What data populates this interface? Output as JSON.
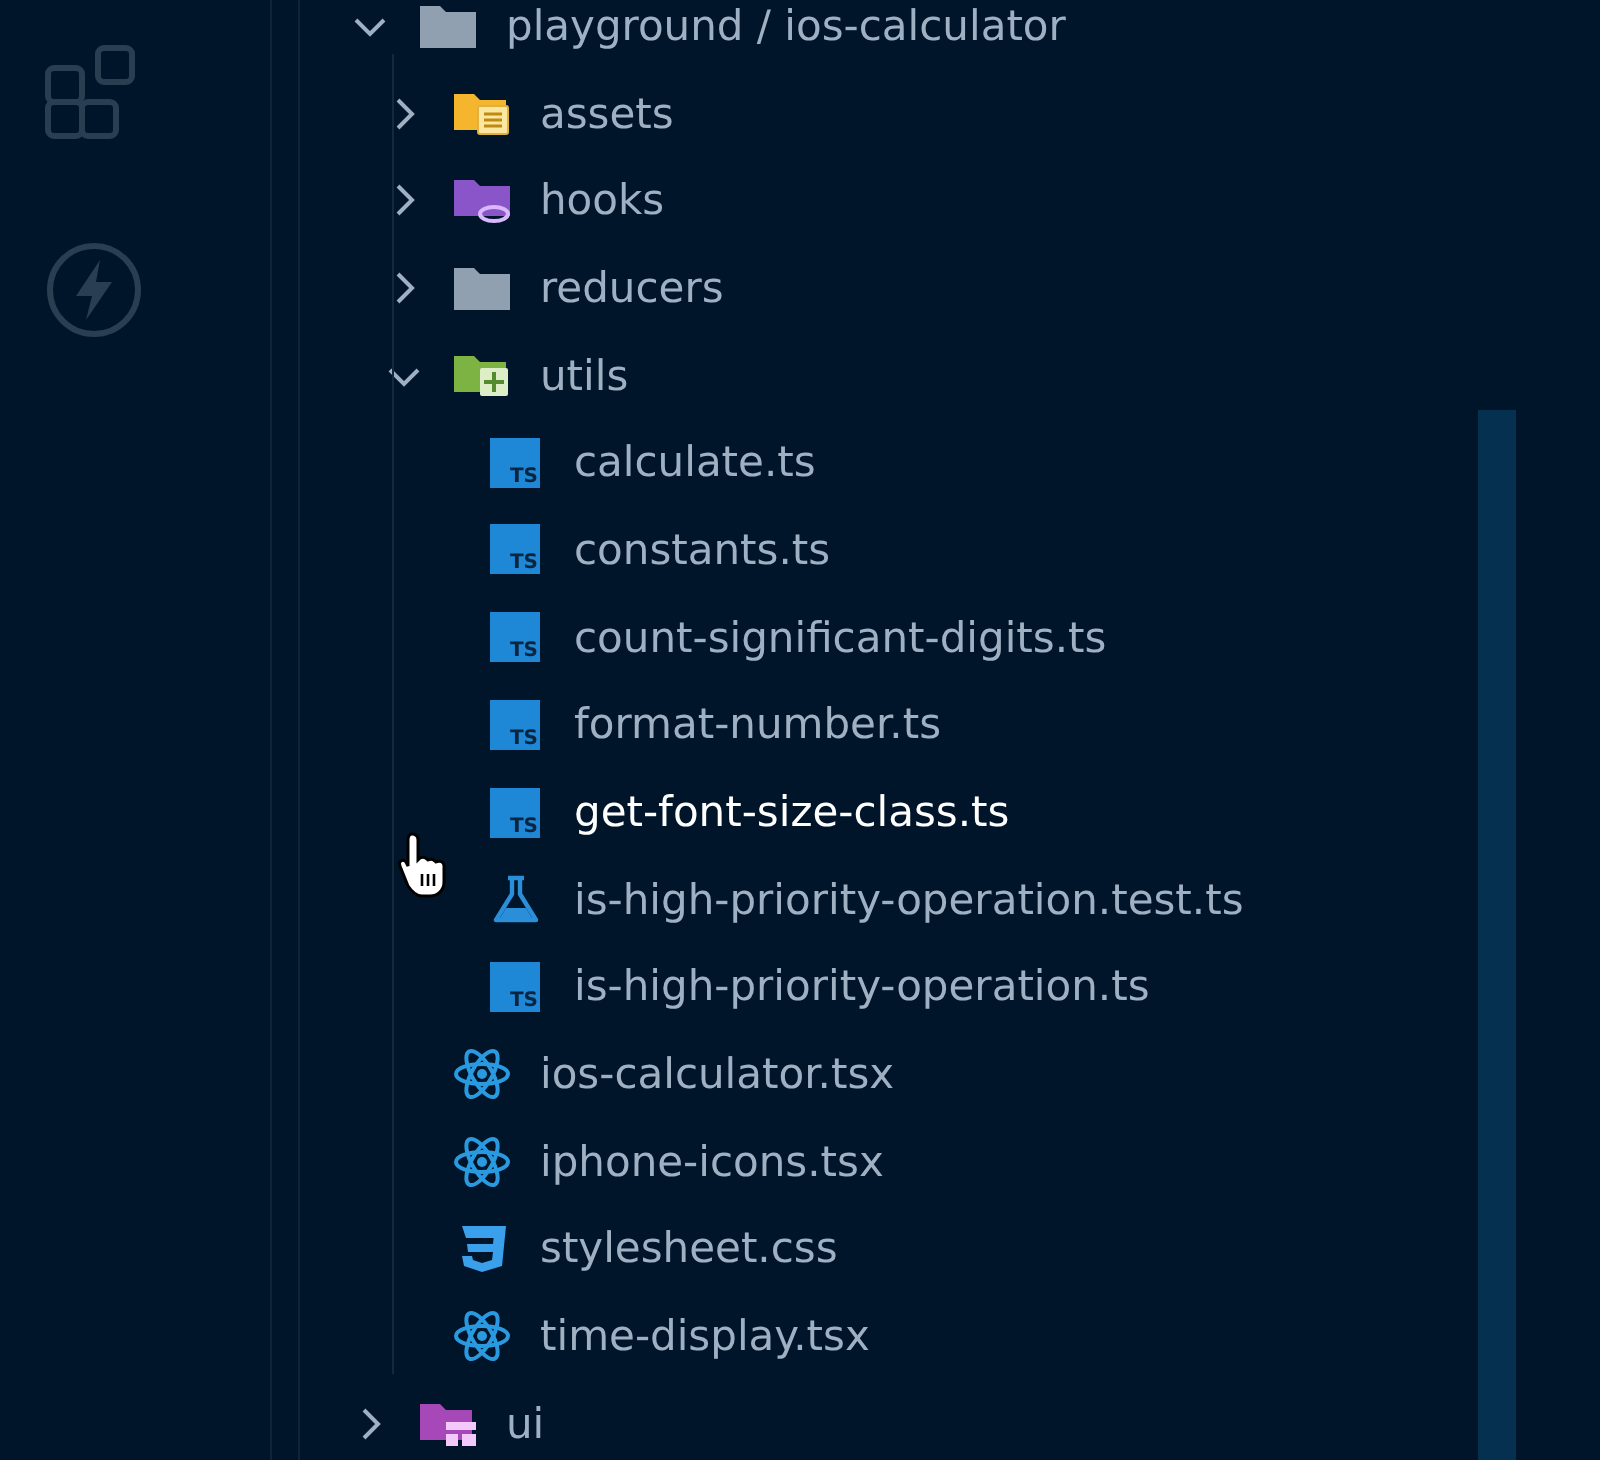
{
  "activity_bar": {
    "items": [
      {
        "kind": "extensions"
      },
      {
        "kind": "lightning"
      }
    ]
  },
  "tree": [
    {
      "label": "playground / ios-calculator",
      "kind": "folder-plain",
      "expanded": true,
      "selected": false,
      "children": [
        {
          "label": "assets",
          "kind": "folder-assets",
          "expanded": false,
          "selected": false
        },
        {
          "label": "hooks",
          "kind": "folder-hooks",
          "expanded": false,
          "selected": false
        },
        {
          "label": "reducers",
          "kind": "folder-plain",
          "expanded": false,
          "selected": false
        },
        {
          "label": "utils",
          "kind": "folder-utils",
          "expanded": true,
          "selected": false,
          "children": [
            {
              "label": "calculate.ts",
              "kind": "ts",
              "badge": "TS",
              "selected": false
            },
            {
              "label": "constants.ts",
              "kind": "ts",
              "badge": "TS",
              "selected": false
            },
            {
              "label": "count-significant-digits.ts",
              "kind": "ts",
              "badge": "TS",
              "selected": false
            },
            {
              "label": "format-number.ts",
              "kind": "ts",
              "badge": "TS",
              "selected": false
            },
            {
              "label": "get-font-size-class.ts",
              "kind": "ts",
              "badge": "TS",
              "selected": true
            },
            {
              "label": "is-high-priority-operation.test.ts",
              "kind": "test",
              "selected": false
            },
            {
              "label": "is-high-priority-operation.ts",
              "kind": "ts",
              "badge": "TS",
              "selected": false
            }
          ]
        },
        {
          "label": "ios-calculator.tsx",
          "kind": "react",
          "selected": false
        },
        {
          "label": "iphone-icons.tsx",
          "kind": "react",
          "selected": false
        },
        {
          "label": "stylesheet.css",
          "kind": "css",
          "selected": false
        },
        {
          "label": "time-display.tsx",
          "kind": "react",
          "selected": false
        }
      ]
    },
    {
      "label": "ui",
      "kind": "folder-ui",
      "expanded": false,
      "selected": false
    }
  ]
}
